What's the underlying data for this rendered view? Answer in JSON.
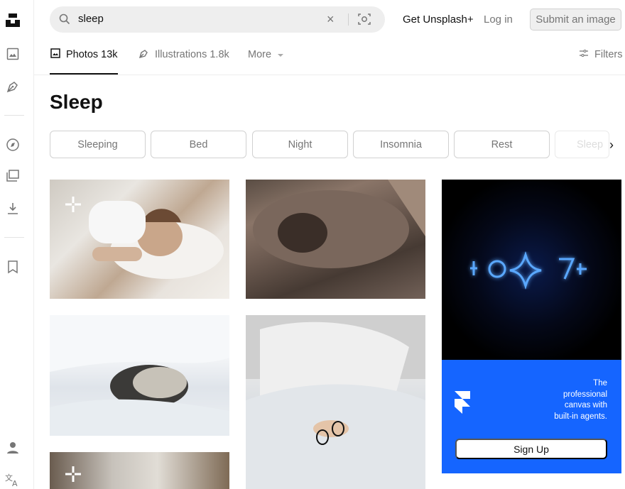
{
  "search": {
    "query": "sleep"
  },
  "header": {
    "get_plus": "Get Unsplash+",
    "login": "Log in",
    "submit": "Submit an image"
  },
  "tabs": [
    {
      "label": "Photos 13k",
      "icon": "image-icon",
      "active": true
    },
    {
      "label": "Illustrations 1.8k",
      "icon": "pen-tool-icon",
      "active": false
    },
    {
      "label": "More",
      "icon": "chevron-down-icon",
      "active": false
    }
  ],
  "filters": {
    "label": "Filters"
  },
  "page": {
    "title": "Sleep"
  },
  "chips": [
    "Sleeping",
    "Bed",
    "Night",
    "Insomnia",
    "Rest",
    "Sleep"
  ],
  "ad": {
    "text": "The\nprofessional\ncanvas with\nbuilt-in agents.",
    "cta": "Sign Up"
  },
  "rail_icons": [
    "unsplash-logo",
    "image-icon",
    "pen-tool-icon",
    "compass-icon",
    "collections-icon",
    "download-icon",
    "bookmark-icon",
    "user-icon",
    "translate-icon"
  ],
  "colors": {
    "ad_blue": "#1565ff",
    "text": "#111111",
    "muted": "#767676"
  }
}
